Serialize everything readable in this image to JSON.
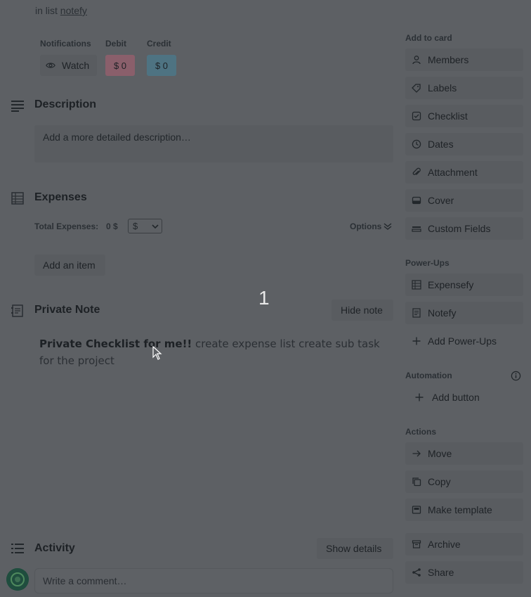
{
  "header": {
    "in_list_prefix": "in list",
    "list_name": "notefy"
  },
  "meta": {
    "notifications_label": "Notifications",
    "watch_label": "Watch",
    "debit_label": "Debit",
    "debit_value": "$ 0",
    "credit_label": "Credit",
    "credit_value": "$ 0"
  },
  "description": {
    "title": "Description",
    "placeholder": "Add a more detailed description…"
  },
  "expenses": {
    "title": "Expenses",
    "total_label": "Total Expenses:",
    "total_value": "0 $",
    "currency": "$",
    "options_label": "Options",
    "add_item_label": "Add an item"
  },
  "private_note": {
    "title": "Private Note",
    "hide_label": "Hide note",
    "bold_text": "Private Checklist for me!!",
    "body_text": " create expense list create sub task for the project"
  },
  "overlay_number": "1",
  "activity": {
    "title": "Activity",
    "show_details_label": "Show details",
    "comment_placeholder": "Write a comment…"
  },
  "sidebar": {
    "add_to_card_label": "Add to card",
    "add_to_card": [
      "Members",
      "Labels",
      "Checklist",
      "Dates",
      "Attachment",
      "Cover",
      "Custom Fields"
    ],
    "powerups_label": "Power-Ups",
    "powerups": [
      "Expensefy",
      "Notefy",
      "Add Power-Ups"
    ],
    "automation_label": "Automation",
    "add_button_label": "Add button",
    "actions_label": "Actions",
    "actions": [
      "Move",
      "Copy",
      "Make template",
      "Archive",
      "Share"
    ]
  },
  "colors": {
    "overlay_bg": "#5d6064",
    "debit_bg": "#8a5f6b",
    "credit_bg": "#4e7382"
  }
}
